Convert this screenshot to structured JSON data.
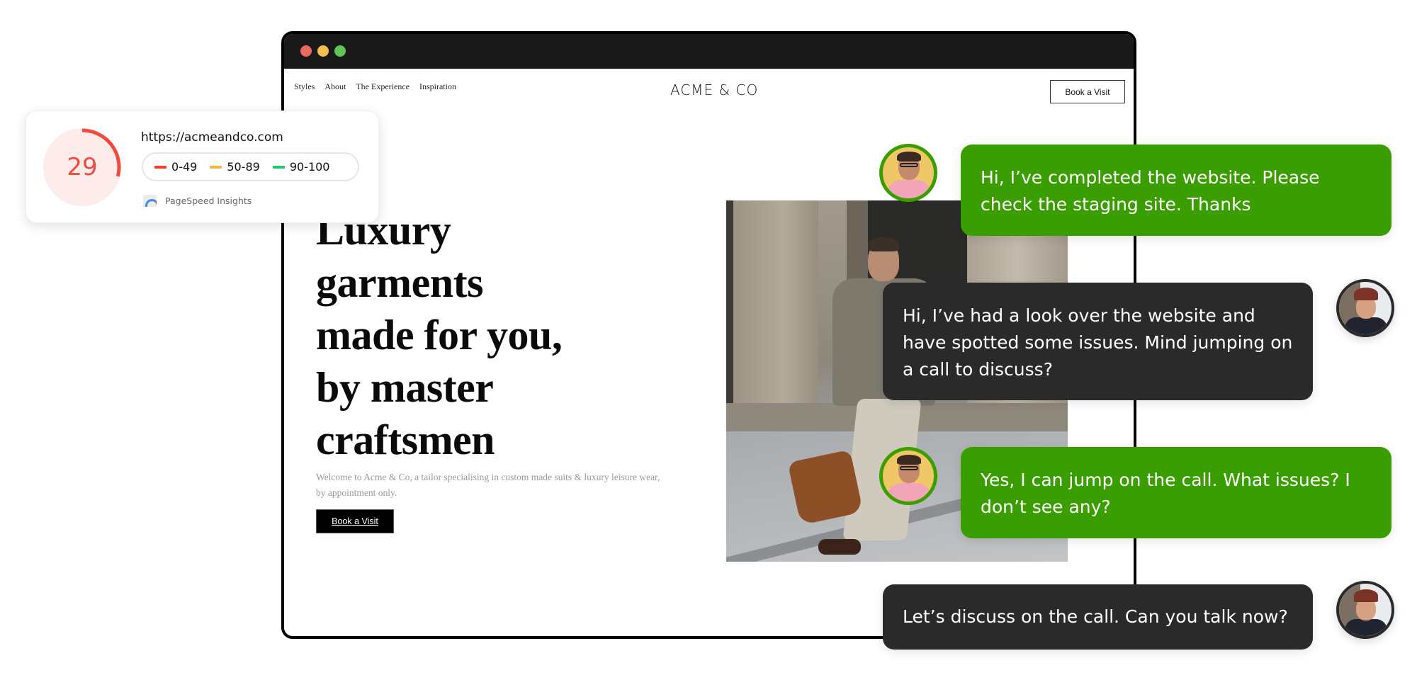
{
  "browser": {
    "window_controls": [
      "close",
      "minimize",
      "maximize"
    ],
    "site": {
      "nav": {
        "links": [
          "Styles",
          "About",
          "The Experience",
          "Inspiration"
        ],
        "logo": "ACME & CO",
        "cta_label": "Book a Visit"
      },
      "hero": {
        "headline_lines": [
          "Luxury",
          "garments",
          "made for you,",
          "by master",
          "craftsmen"
        ],
        "intro": "Welcome to Acme & Co, a tailor specialising in custom made suits & luxury leisure wear, by appointment only.",
        "cta_label": "Book a Visit",
        "image_alt": "Man in jacket carrying a brown bag walking past stone columns"
      }
    }
  },
  "pagespeed": {
    "score": "29",
    "score_fraction": 0.29,
    "url": "https://acmeandco.com",
    "legend": [
      {
        "label": "0-49",
        "color": "#ff3b30"
      },
      {
        "label": "50-89",
        "color": "#f7b742"
      },
      {
        "label": "90-100",
        "color": "#1ec96a"
      }
    ],
    "brand": "PageSpeed Insights",
    "colors": {
      "fail": "#ef4b3f",
      "gauge_bg": "#fdecea"
    }
  },
  "chat": {
    "colors": {
      "designer": "#3a9e00",
      "client": "#2a2a2a"
    },
    "messages": [
      {
        "sender": "designer",
        "text": "Hi, I’ve completed the website. Please check the staging site. Thanks"
      },
      {
        "sender": "client",
        "text": "Hi, I’ve had a look over the website and have spotted some issues. Mind jumping on a call to discuss?"
      },
      {
        "sender": "designer",
        "text": "Yes, I can jump on the call. What issues? I don’t see any?"
      },
      {
        "sender": "client",
        "text": "Let’s discuss on the call. Can you talk now?"
      }
    ]
  }
}
